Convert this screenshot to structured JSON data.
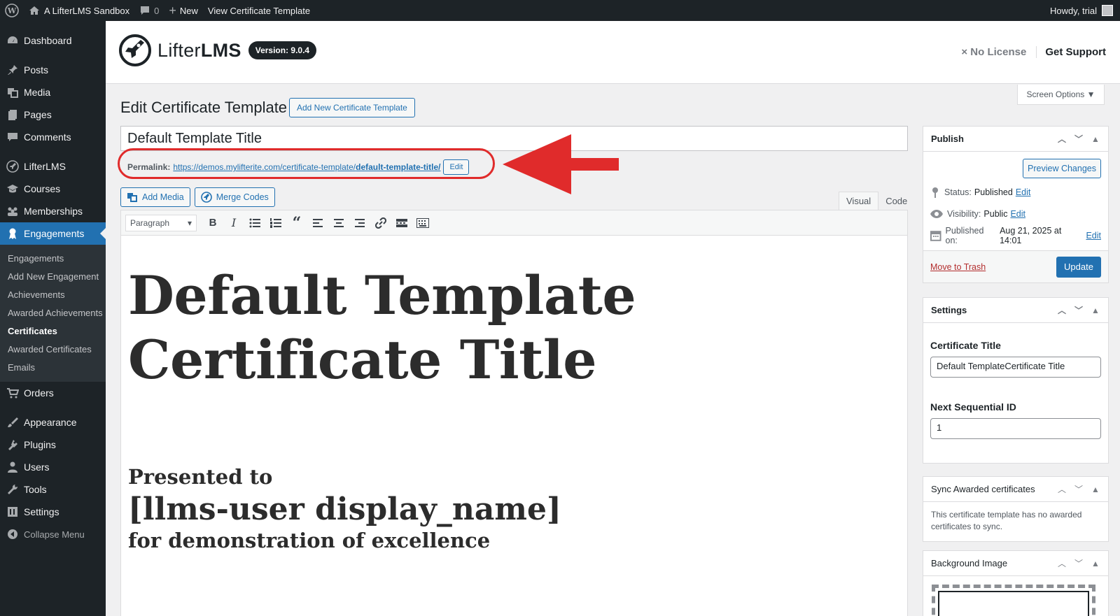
{
  "adminbar": {
    "site_name": "A LifterLMS Sandbox",
    "comments_count": "0",
    "new_label": "New",
    "view_label": "View Certificate Template",
    "howdy": "Howdy, trial"
  },
  "sidebar": {
    "items": [
      {
        "label": "Dashboard",
        "icon": "dashboard-icon"
      },
      {
        "label": "Posts",
        "icon": "pin-icon"
      },
      {
        "label": "Media",
        "icon": "media-icon"
      },
      {
        "label": "Pages",
        "icon": "pages-icon"
      },
      {
        "label": "Comments",
        "icon": "comments-icon"
      },
      {
        "label": "LifterLMS",
        "icon": "rocket-icon"
      },
      {
        "label": "Courses",
        "icon": "courses-icon"
      },
      {
        "label": "Memberships",
        "icon": "groups-icon"
      },
      {
        "label": "Engagements",
        "icon": "award-icon"
      },
      {
        "label": "Orders",
        "icon": "cart-icon"
      },
      {
        "label": "Appearance",
        "icon": "brush-icon"
      },
      {
        "label": "Plugins",
        "icon": "plug-icon"
      },
      {
        "label": "Users",
        "icon": "user-icon"
      },
      {
        "label": "Tools",
        "icon": "wrench-icon"
      },
      {
        "label": "Settings",
        "icon": "settings-icon"
      },
      {
        "label": "Collapse Menu",
        "icon": "collapse-icon"
      }
    ],
    "submenu": [
      "Engagements",
      "Add New Engagement",
      "Achievements",
      "Awarded Achievements",
      "Certificates",
      "Awarded Certificates",
      "Emails"
    ]
  },
  "header": {
    "logo_prefix": "Lifter",
    "logo_suffix": "LMS",
    "version": "Version: 9.0.4",
    "no_license": "× No License",
    "get_support": "Get Support"
  },
  "screen_options": "Screen Options ▼",
  "page": {
    "title": "Edit Certificate Template",
    "add_new": "Add New Certificate Template",
    "post_title": "Default Template Title",
    "permalink_label": "Permalink:",
    "permalink_base": "https://demos.mylifterite.com/certificate-template/",
    "permalink_slug": "default-template-title/",
    "permalink_edit": "Edit"
  },
  "editor": {
    "add_media": "Add Media",
    "merge_codes": "Merge Codes",
    "tab_visual": "Visual",
    "tab_code": "Code",
    "format": "Paragraph",
    "heading_line1": "Default Template",
    "heading_line2": "Certificate Title",
    "presented": "Presented to",
    "username": "[llms-user display_name]",
    "demo": "for demonstration of excellence"
  },
  "publish": {
    "title": "Publish",
    "preview": "Preview Changes",
    "status_label": "Status:",
    "status_value": "Published",
    "visibility_label": "Visibility:",
    "visibility_value": "Public",
    "published_label": "Published on:",
    "published_value": "Aug 21, 2025 at 14:01",
    "edit": "Edit",
    "trash": "Move to Trash",
    "update": "Update"
  },
  "settings": {
    "title": "Settings",
    "cert_title_label": "Certificate Title",
    "cert_title_value": "Default TemplateCertificate Title",
    "seq_label": "Next Sequential ID",
    "seq_value": "1"
  },
  "sync": {
    "title": "Sync Awarded certificates",
    "text": "This certificate template has no awarded certificates to sync."
  },
  "background": {
    "title": "Background Image"
  },
  "colors": {
    "accent": "#2271b1",
    "annotation": "#e02b2b"
  }
}
